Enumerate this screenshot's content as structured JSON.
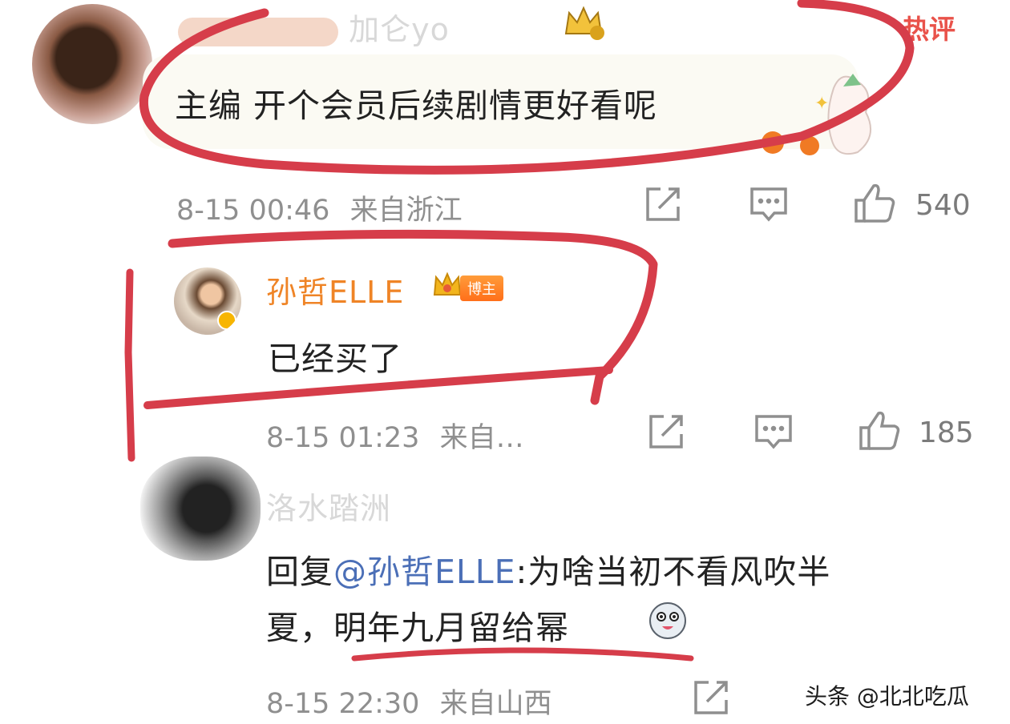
{
  "colors": {
    "highlight_red": "#d63d4a",
    "username_orange": "#ef8426",
    "mention_blue": "#4b6fb7",
    "meta_grey": "#8f8f8f",
    "badge_orange": "#ff7a22",
    "hot_red": "#e9524a"
  },
  "comments": [
    {
      "user": "加仑yo",
      "hot_label": "热评",
      "text": "主编 开个会员后续剧情更好看呢",
      "time": "8-15 00:46",
      "location": "来自浙江",
      "likes": "540"
    },
    {
      "user": "孙哲ELLE",
      "role_badge": "博主",
      "text": "已经买了",
      "time": "8-15 01:23",
      "location": "来自…",
      "likes": "185"
    },
    {
      "user": "洛水踏洲",
      "reply_prefix": "回复",
      "mention": "@孙哲ELLE",
      "text_line1_rest": ":为啥当初不看风吹半",
      "text_line2": "夏，明年九月留给幂",
      "time": "8-15 22:30",
      "location": "来自山西"
    }
  ],
  "watermark": "头条 @北北吃瓜",
  "icons": [
    "share-icon",
    "comment-icon",
    "like-icon",
    "crown-icon",
    "verified-icon",
    "emoji-sticker-icon",
    "rabbit-sticker-icon"
  ]
}
